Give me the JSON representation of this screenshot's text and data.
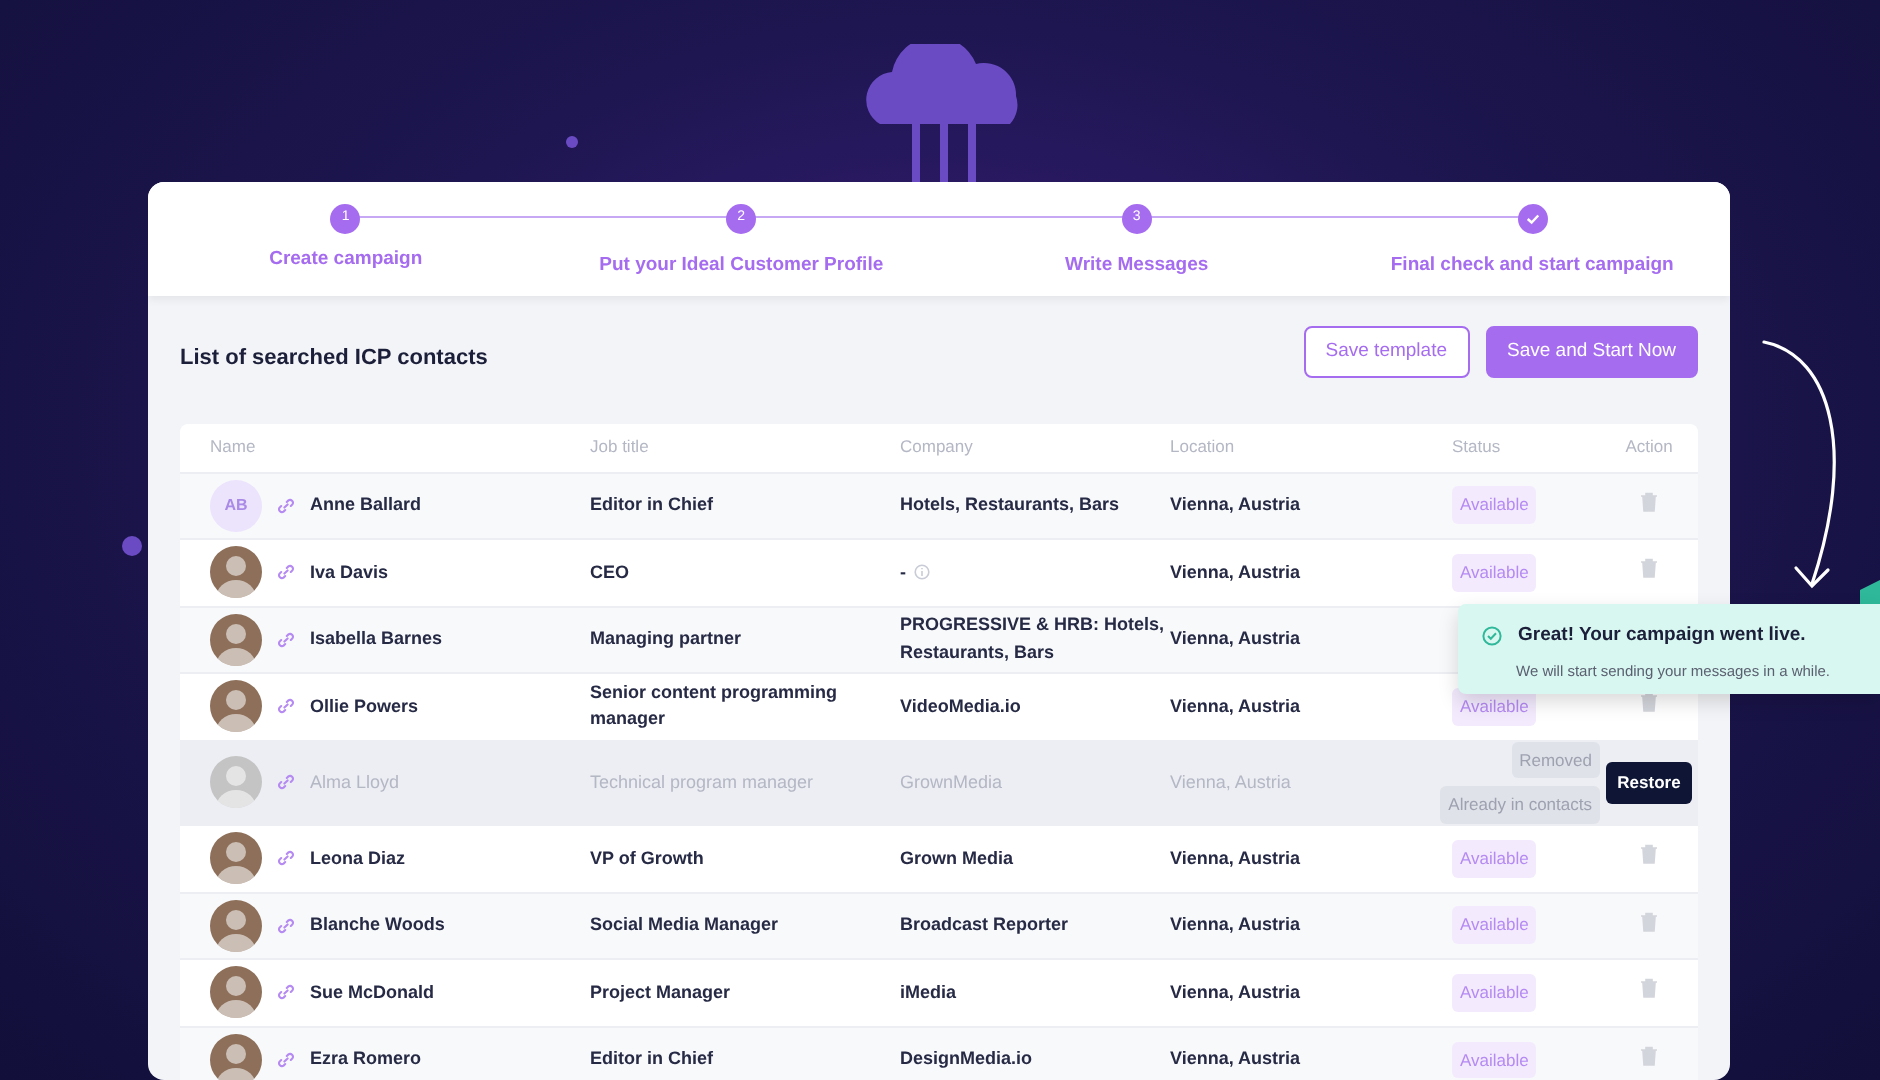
{
  "stepper": {
    "steps": [
      {
        "kind": "number",
        "marker": "1",
        "label": "Create campaign"
      },
      {
        "kind": "number",
        "marker": "2",
        "label": "Put your Ideal Customer Profile"
      },
      {
        "kind": "number",
        "marker": "3",
        "label": "Write Messages"
      },
      {
        "kind": "check",
        "label": "Final check and start campaign"
      }
    ]
  },
  "list": {
    "title": "List of searched ICP contacts",
    "buttons": [
      {
        "kind": "outline",
        "label": "Save template"
      },
      {
        "kind": "primary",
        "label": "Save and Start Now"
      }
    ]
  },
  "table": {
    "columns": [
      "Name",
      "Job title",
      "Company",
      "Location",
      "Status",
      "Action"
    ],
    "rows": [
      {
        "avatar": {
          "kind": "initials",
          "text": "AB"
        },
        "name": "Anne Ballard",
        "job_title": "Editor in Chief",
        "company": "Hotels, Restaurants, Bars",
        "info_icon": false,
        "location": "Vienna, Austria",
        "status": "Available",
        "disabled": false,
        "removed": false
      },
      {
        "avatar": {
          "kind": "photo"
        },
        "name": "Iva Davis",
        "job_title": "CEO",
        "company": "-",
        "info_icon": true,
        "location": "Vienna, Austria",
        "status": "Available",
        "disabled": false,
        "removed": false
      },
      {
        "avatar": {
          "kind": "photo"
        },
        "name": "Isabella Barnes",
        "job_title": "Managing partner",
        "company": "PROGRESSIVE & HRB: Hotels, Restaurants, Bars",
        "info_icon": false,
        "location": "Vienna, Austria",
        "disabled": false,
        "removed": false
      },
      {
        "avatar": {
          "kind": "photo"
        },
        "name": "Ollie Powers",
        "job_title": "Senior content programming manager",
        "company": "VideoMedia.io",
        "info_icon": false,
        "location": "Vienna, Austria",
        "status": "Available",
        "disabled": false,
        "removed": false
      },
      {
        "avatar": {
          "kind": "photo"
        },
        "name": "Alma Lloyd",
        "job_title": "Technical program manager",
        "company": "GrownMedia",
        "info_icon": false,
        "location": "Vienna, Austria",
        "status": "Already in contacts",
        "disabled": true,
        "removed": true,
        "removed_label": "Removed",
        "action_label": "Restore"
      },
      {
        "avatar": {
          "kind": "photo"
        },
        "name": "Leona Diaz",
        "job_title": "VP of Growth",
        "company": "Grown Media",
        "info_icon": false,
        "location": "Vienna, Austria",
        "status": "Available",
        "disabled": false,
        "removed": false
      },
      {
        "avatar": {
          "kind": "photo"
        },
        "name": "Blanche Woods",
        "job_title": "Social Media Manager",
        "company": "Broadcast Reporter",
        "info_icon": false,
        "location": "Vienna, Austria",
        "status": "Available",
        "disabled": false,
        "removed": false
      },
      {
        "avatar": {
          "kind": "photo"
        },
        "name": "Sue McDonald",
        "job_title": "Project Manager",
        "company": "iMedia",
        "info_icon": false,
        "location": "Vienna, Austria",
        "status": "Available",
        "disabled": false,
        "removed": false
      },
      {
        "avatar": {
          "kind": "photo"
        },
        "name": "Ezra Romero",
        "job_title": "Editor in Chief",
        "company": "DesignMedia.io",
        "info_icon": false,
        "location": "Vienna, Austria",
        "status": "Available",
        "disabled": false,
        "removed": false
      }
    ]
  },
  "toast": {
    "title": "Great! Your campaign went live.",
    "message": "We will start sending your messages in a while."
  }
}
